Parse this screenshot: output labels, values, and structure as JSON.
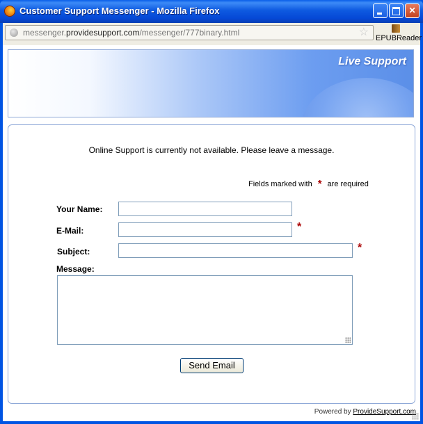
{
  "window": {
    "title": "Customer Support Messenger - Mozilla Firefox"
  },
  "addressbar": {
    "url_prefix": "messenger.",
    "url_domain": "providesupport.com",
    "url_path": "/messenger/777binary.html"
  },
  "toolbar": {
    "epub_label": "EPUBReader"
  },
  "banner": {
    "title": "Live Support"
  },
  "form": {
    "notice": "Online Support is currently not available. Please leave a message.",
    "required_note_before": "Fields marked with",
    "required_note_star": "*",
    "required_note_after": "are required",
    "name_label": "Your Name:",
    "email_label": "E-Mail:",
    "subject_label": "Subject:",
    "message_label": "Message:",
    "name_value": "",
    "email_value": "",
    "subject_value": "",
    "message_value": "",
    "email_required_mark": "*",
    "subject_required_mark": "*",
    "send_label": "Send Email"
  },
  "footer": {
    "powered_by": "Powered by",
    "powered_link": "ProvideSupport.com"
  }
}
